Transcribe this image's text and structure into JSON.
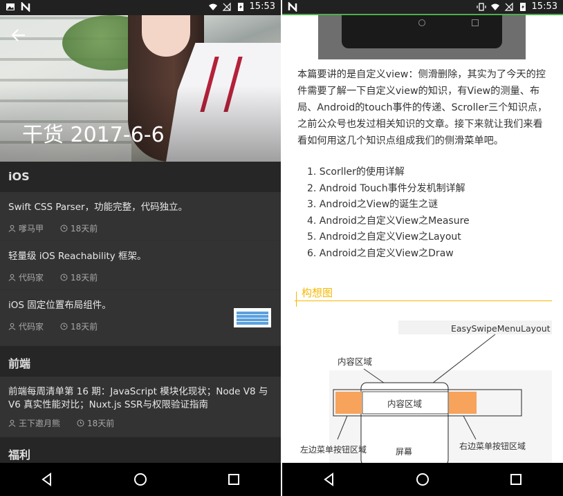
{
  "left": {
    "status_time": "15:53",
    "hero_title": "干货 2017-6-6",
    "sections": [
      {
        "title": "iOS",
        "items": [
          {
            "title": "Swift CSS Parser，功能完整，代码独立。",
            "author": "嗲马甲",
            "time": "18天前"
          },
          {
            "title": "轻量级 iOS Reachability 框架。",
            "author": "代码家",
            "time": "18天前"
          },
          {
            "title": "iOS 固定位置布局组件。",
            "author": "代码家",
            "time": "18天前"
          }
        ]
      },
      {
        "title": "前端",
        "items": [
          {
            "title": "前端每周清单第 16 期：JavaScript 模块化现状；Node V8 与 V6 真实性能对比；Nuxt.js SSR与权限验证指南",
            "author": "王下邀月熊",
            "time": "18天前"
          }
        ]
      },
      {
        "title": "福利",
        "items": []
      }
    ]
  },
  "right": {
    "status_time": "15:53",
    "article_text": "本篇要讲的是自定义view：侧滑删除，其实为了今天的控件需要了解一下自定义view的知识，有View的测量、布局、Android的touch事件的传递、Scroller三个知识点，之前公众号也发过相关知识的文章。接下来就让我们来看看如何用这几个知识点组成我们的侧滑菜单吧。",
    "list": [
      "1. Scorller的使用详解",
      "2. Android Touch事件分发机制详解",
      "3. Android之View的诞生之谜",
      "4. Android之自定义View之Measure",
      "5. Android之自定义View之Layout",
      "6. Android之自定义View之Draw"
    ],
    "section_heading": "构想图",
    "diagram": {
      "label_layout": "EasySwipeMenuLayout",
      "label_content_top": "内容区域",
      "label_content_mid": "内容区域",
      "label_left_menu": "左边菜单按钮区域",
      "label_right_menu": "右边菜单按钮区域",
      "label_screen": "屏幕"
    }
  },
  "colors": {
    "accent_yellow": "#f5b800",
    "menu_orange": "#f7a35c",
    "dark_bg": "#303030"
  }
}
